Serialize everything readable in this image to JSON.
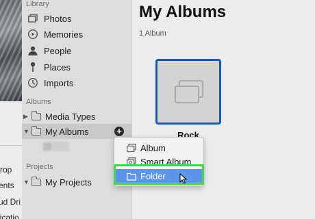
{
  "background_window": {
    "items": [
      "rop",
      "ents",
      "ud Dri",
      "licatio"
    ]
  },
  "sidebar": {
    "library_header": "Library",
    "library_items": [
      {
        "label": "Photos",
        "icon": "photos-icon"
      },
      {
        "label": "Memories",
        "icon": "memories-icon"
      },
      {
        "label": "People",
        "icon": "people-icon"
      },
      {
        "label": "Places",
        "icon": "places-pin-icon"
      },
      {
        "label": "Imports",
        "icon": "imports-clock-icon"
      }
    ],
    "albums_header": "Albums",
    "album_items": [
      {
        "label": "Media Types",
        "disclosure": "▶"
      },
      {
        "label": "My Albums",
        "disclosure": "▼"
      }
    ],
    "add_button": "+",
    "projects_header": "Projects",
    "project_items": [
      {
        "label": "My Projects",
        "disclosure": "▼"
      }
    ]
  },
  "main": {
    "title": "My Albums",
    "count": "1 Album",
    "album": {
      "name": "Rock"
    }
  },
  "context_menu": {
    "items": [
      {
        "label": "Album",
        "icon": "album-icon"
      },
      {
        "label": "Smart Album",
        "icon": "smart-album-icon"
      },
      {
        "label": "Folder",
        "icon": "folder-icon",
        "highlighted": true
      }
    ]
  },
  "colors": {
    "selection_blue": "#5b96e8",
    "thumb_border": "#1c5aa8",
    "callout_green": "#4fd24f"
  }
}
